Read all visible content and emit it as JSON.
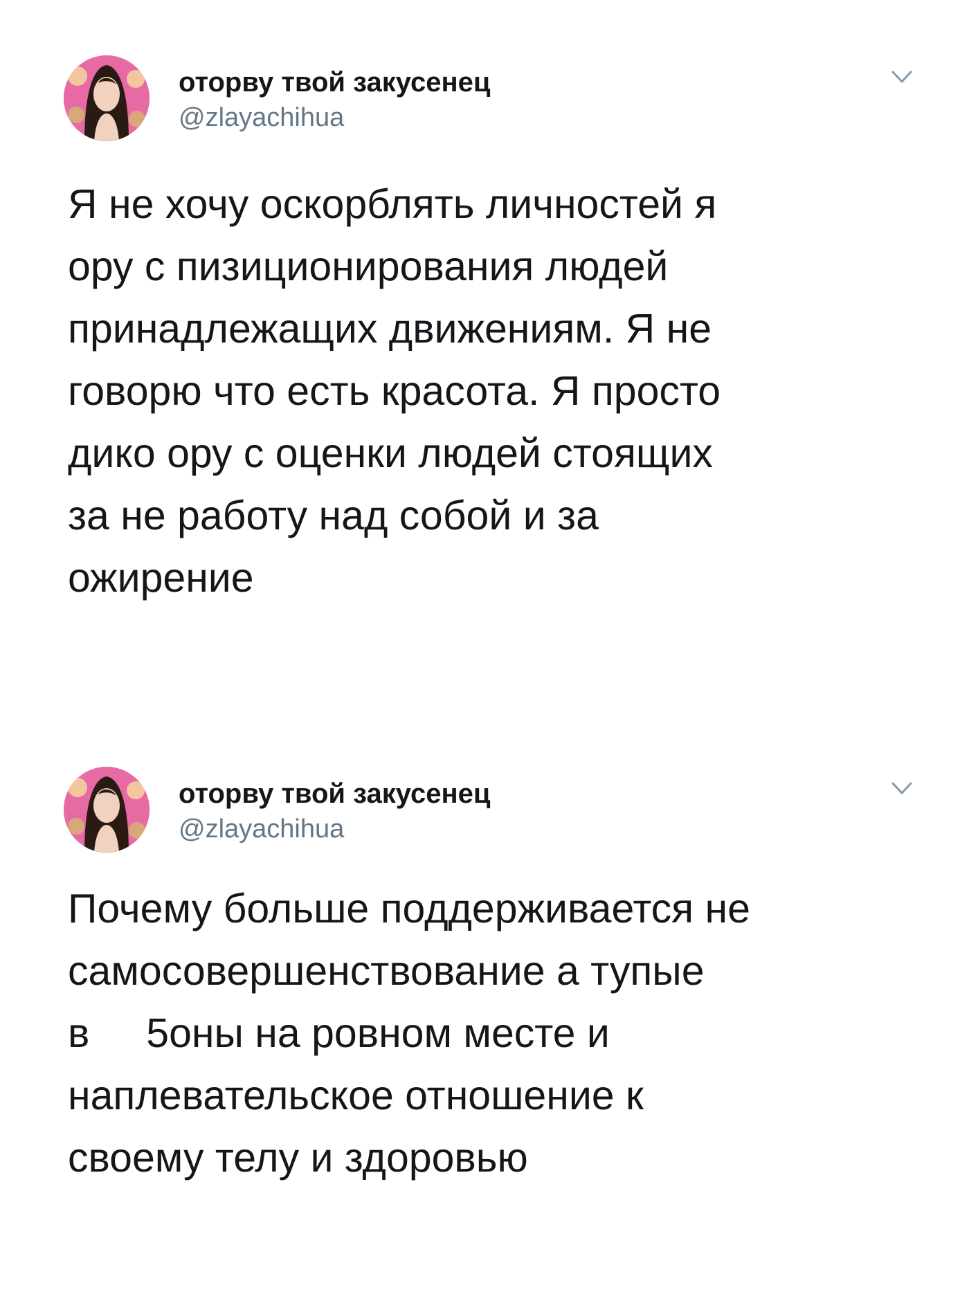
{
  "tweets": [
    {
      "user": {
        "display_name": "оторву твой закусенец",
        "handle": "@zlayachihua"
      },
      "icons": {
        "avatar": "profile-photo",
        "menu": "chevron-down-icon"
      },
      "text_lines": [
        "Я не хочу оскорблять личностей я",
        "ору с пизиционирования людей",
        "принадлежащих движениям. Я не",
        "говорю что есть красота. Я просто",
        "дико ору с оценки людей стоящих",
        "за не работу над собой и за",
        "ожирение"
      ]
    },
    {
      "user": {
        "display_name": "оторву твой закусенец",
        "handle": "@zlayachihua"
      },
      "icons": {
        "avatar": "profile-photo",
        "menu": "chevron-down-icon"
      },
      "text_lines": [
        "Почему больше поддерживается не",
        "самосовершенствование а тупые",
        "в     5оны на ровном месте и",
        "наплевательское отношение к",
        "своему телу и здоровью"
      ]
    }
  ],
  "colors": {
    "text": "#14171a",
    "secondary_text": "#657786",
    "avatar_background": "#e86aa4"
  }
}
